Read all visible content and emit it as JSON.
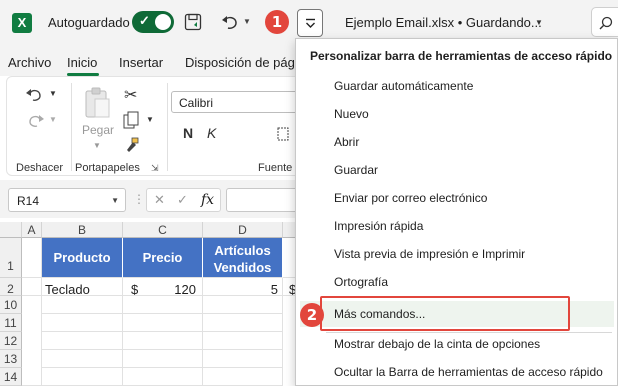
{
  "titlebar": {
    "logo_letter": "X",
    "autosave_label": "Autoguardado",
    "doc_title": "Ejemplo Email.xlsx • Guardando...",
    "badge_1": "1"
  },
  "menu_tabs": [
    "Archivo",
    "Inicio",
    "Insertar",
    "Disposición de pág"
  ],
  "ribbon": {
    "font_name": "Calibri",
    "paste_label": "Pegar",
    "group_undo": "Deshacer",
    "group_clipboard": "Portapapeles",
    "group_font": "Fuente",
    "bold": "N",
    "italic": "K"
  },
  "formula_bar": {
    "name_box": "R14",
    "fx_label": "fx"
  },
  "grid": {
    "col_headers": [
      "A",
      "B",
      "C",
      "D"
    ],
    "row_headers": [
      "1",
      "2",
      "10",
      "11",
      "12",
      "13",
      "14"
    ],
    "header_row": [
      "Producto",
      "Precio",
      "Artículos Vendidos"
    ],
    "row2": {
      "producto": "Teclado",
      "currency": "$",
      "precio": "120",
      "vendidos": "5",
      "extra": "$"
    }
  },
  "dropdown": {
    "title": "Personalizar barra de herramientas de acceso rápido",
    "items": [
      "Guardar automáticamente",
      "Nuevo",
      "Abrir",
      "Guardar",
      "Enviar por correo electrónico",
      "Impresión rápida",
      "Vista previa de impresión e Imprimir",
      "Ortografía",
      "Más comandos...",
      "Mostrar debajo de la cinta de opciones",
      "Ocultar la Barra de herramientas de acceso rápido"
    ],
    "badge_2": "2"
  },
  "colors": {
    "excel_green": "#107c41",
    "toggle_green": "#0f6a37",
    "header_blue": "#4472c4",
    "badge_red": "#e2463c",
    "highlight_box": "#e2463c"
  }
}
